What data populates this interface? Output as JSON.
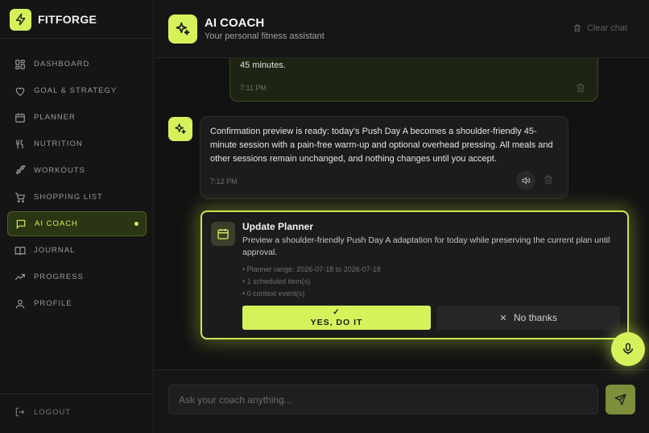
{
  "app": {
    "name": "FITFORGE",
    "accent_color": "#d6f25a"
  },
  "sidebar": {
    "items": [
      {
        "label": "DASHBOARD",
        "icon": "dashboard-icon"
      },
      {
        "label": "GOAL & STRATEGY",
        "icon": "heart-icon"
      },
      {
        "label": "PLANNER",
        "icon": "calendar-icon"
      },
      {
        "label": "NUTRITION",
        "icon": "utensils-icon"
      },
      {
        "label": "WORKOUTS",
        "icon": "dumbbell-icon"
      },
      {
        "label": "SHOPPING LIST",
        "icon": "cart-icon"
      },
      {
        "label": "AI COACH",
        "icon": "chat-icon",
        "active": true
      },
      {
        "label": "JOURNAL",
        "icon": "book-icon"
      },
      {
        "label": "PROGRESS",
        "icon": "trend-icon"
      },
      {
        "label": "PROFILE",
        "icon": "user-icon"
      }
    ],
    "logout_label": "LOGOUT"
  },
  "header": {
    "title": "AI COACH",
    "subtitle": "Your personal fitness assistant",
    "clear_label": "Clear chat"
  },
  "messages": {
    "user": {
      "text": "45 minutes.",
      "time": "7:11 PM"
    },
    "assistant": {
      "text": "Confirmation preview is ready: today's Push Day A becomes a shoulder-friendly 45-minute session with a pain-free warm-up and optional overhead pressing. All meals and other sessions remain unchanged, and nothing changes until you accept.",
      "time": "7:12 PM"
    }
  },
  "action_card": {
    "title": "Update Planner",
    "description": "Preview a shoulder-friendly Push Day A adaptation for today while preserving the current plan until approval.",
    "meta": [
      "• Planner range: 2026-07-18 to 2026-07-18",
      "• 1 scheduled item(s)",
      "• 0 context event(s)"
    ],
    "accept_label": "YES, DO IT",
    "reject_label": "No thanks"
  },
  "composer": {
    "placeholder": "Ask your coach anything..."
  }
}
